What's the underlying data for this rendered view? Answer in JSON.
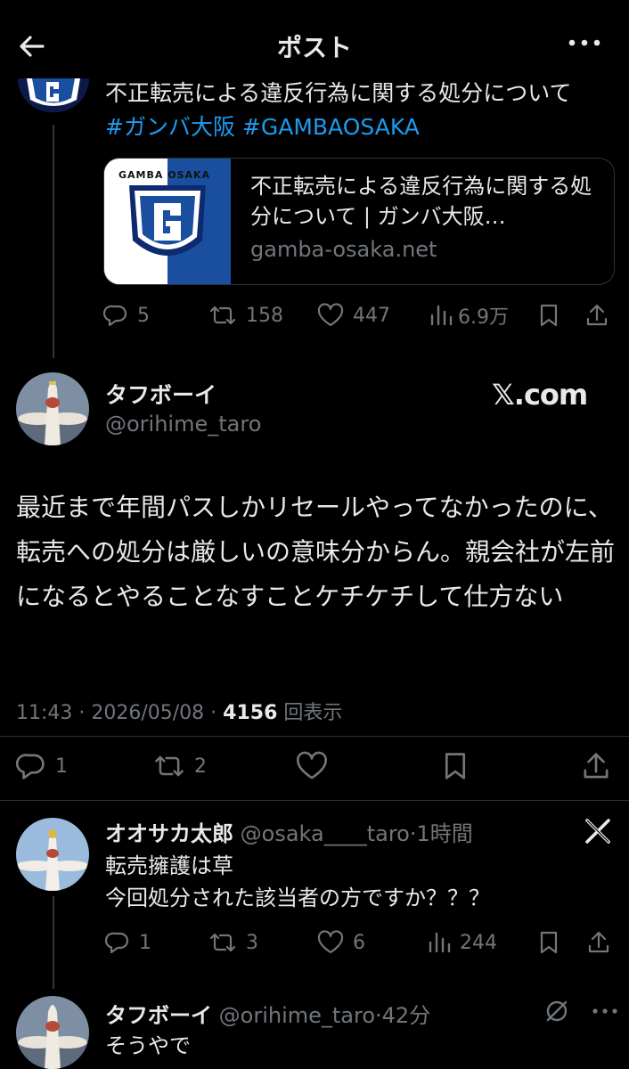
{
  "header": {
    "title": "ポスト",
    "back_icon": "back-arrow-icon",
    "more_icon": "more-dots-icon"
  },
  "quoted": {
    "text": "不正転売による違反行為に関する処分について",
    "hashtag1": "#ガンバ大阪",
    "hashtag2": "#GAMBAOSAKA",
    "card": {
      "logo_text": "GAMBA OSAKA",
      "title": "不正転売による違反行為に関する処分について | ガンバ大阪…",
      "domain": "gamba-osaka.net"
    },
    "actions": {
      "replies": "5",
      "reposts": "158",
      "likes": "447",
      "views": "6.9万"
    }
  },
  "main": {
    "name": "タフボーイ",
    "handle": "@orihime_taro",
    "watermark": "𝕏.com",
    "text": "最近まで年間パスしかリセールやってなかったのに、転売への処分は厳しいの意味分からん。親会社が左前になるとやることなすことケチケチして仕方ない",
    "time": "11:43 · 2026/05/08 · ",
    "views_count": "4156",
    "views_label": " 回表示",
    "actions": {
      "replies": "1",
      "reposts": "2"
    }
  },
  "reply1": {
    "name": "オオサカ太郎",
    "handle": "@osaka____taro",
    "time": "·1時間",
    "line1": "転売擁護は草",
    "line2": "今回処分された該当者の方ですか？？？",
    "actions": {
      "replies": "1",
      "reposts": "3",
      "likes": "6",
      "views": "244"
    }
  },
  "reply2": {
    "name": "タフボーイ",
    "handle": "@orihime_taro",
    "time": "·42分",
    "text": "そうやで"
  },
  "colors": {
    "background": "#000000",
    "accent": "#1d9bf0",
    "muted": "#71767b",
    "card_blue": "#1a4fa0"
  }
}
